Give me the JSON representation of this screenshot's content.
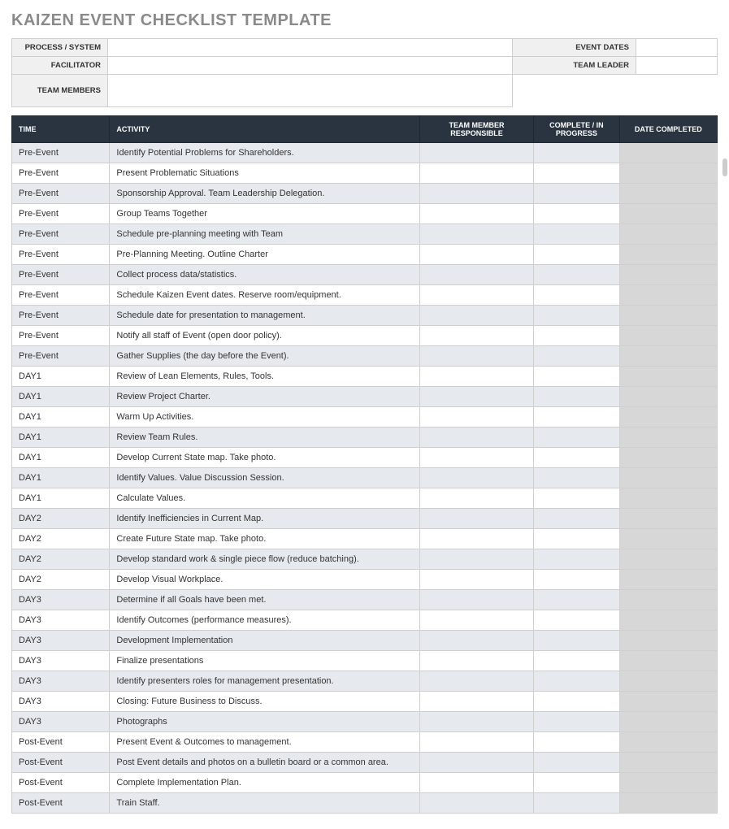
{
  "title": "KAIZEN EVENT CHECKLIST TEMPLATE",
  "info_labels": {
    "process": "PROCESS / SYSTEM",
    "event_dates": "EVENT DATES",
    "facilitator": "FACILITATOR",
    "team_leader": "TEAM LEADER",
    "team_members": "TEAM MEMBERS"
  },
  "info_values": {
    "process": "",
    "event_dates": "",
    "facilitator": "",
    "team_leader": "",
    "team_members": ""
  },
  "columns": {
    "time": "TIME",
    "activity": "ACTIVITY",
    "responsible": "TEAM MEMBER RESPONSIBLE",
    "status": "COMPLETE / IN PROGRESS",
    "date": "DATE COMPLETED"
  },
  "rows": [
    {
      "time": "Pre-Event",
      "activity": "Identify Potential Problems for Shareholders.",
      "responsible": "",
      "status": "",
      "date": ""
    },
    {
      "time": "Pre-Event",
      "activity": "Present Problematic Situations",
      "responsible": "",
      "status": "",
      "date": ""
    },
    {
      "time": "Pre-Event",
      "activity": "Sponsorship Approval. Team Leadership Delegation.",
      "responsible": "",
      "status": "",
      "date": ""
    },
    {
      "time": "Pre-Event",
      "activity": "Group Teams Together",
      "responsible": "",
      "status": "",
      "date": ""
    },
    {
      "time": "Pre-Event",
      "activity": "Schedule pre-planning meeting with Team",
      "responsible": "",
      "status": "",
      "date": ""
    },
    {
      "time": "Pre-Event",
      "activity": "Pre-Planning Meeting. Outline Charter",
      "responsible": "",
      "status": "",
      "date": ""
    },
    {
      "time": "Pre-Event",
      "activity": "Collect process data/statistics.",
      "responsible": "",
      "status": "",
      "date": ""
    },
    {
      "time": "Pre-Event",
      "activity": "Schedule Kaizen Event dates. Reserve room/equipment.",
      "responsible": "",
      "status": "",
      "date": ""
    },
    {
      "time": "Pre-Event",
      "activity": "Schedule date for presentation to management.",
      "responsible": "",
      "status": "",
      "date": ""
    },
    {
      "time": "Pre-Event",
      "activity": "Notify all staff of Event (open door policy).",
      "responsible": "",
      "status": "",
      "date": ""
    },
    {
      "time": "Pre-Event",
      "activity": "Gather Supplies (the day before the Event).",
      "responsible": "",
      "status": "",
      "date": ""
    },
    {
      "time": "DAY1",
      "activity": "Review of Lean Elements, Rules, Tools.",
      "responsible": "",
      "status": "",
      "date": ""
    },
    {
      "time": "DAY1",
      "activity": "Review Project Charter.",
      "responsible": "",
      "status": "",
      "date": ""
    },
    {
      "time": "DAY1",
      "activity": "Warm Up Activities.",
      "responsible": "",
      "status": "",
      "date": ""
    },
    {
      "time": "DAY1",
      "activity": "Review Team Rules.",
      "responsible": "",
      "status": "",
      "date": ""
    },
    {
      "time": "DAY1",
      "activity": "Develop Current State map. Take photo.",
      "responsible": "",
      "status": "",
      "date": ""
    },
    {
      "time": "DAY1",
      "activity": "Identify Values. Value Discussion Session.",
      "responsible": "",
      "status": "",
      "date": ""
    },
    {
      "time": "DAY1",
      "activity": "Calculate Values.",
      "responsible": "",
      "status": "",
      "date": ""
    },
    {
      "time": "DAY2",
      "activity": "Identify Inefficiencies in Current Map.",
      "responsible": "",
      "status": "",
      "date": ""
    },
    {
      "time": "DAY2",
      "activity": "Create Future State map. Take photo.",
      "responsible": "",
      "status": "",
      "date": ""
    },
    {
      "time": "DAY2",
      "activity": "Develop standard work & single piece flow (reduce batching).",
      "responsible": "",
      "status": "",
      "date": ""
    },
    {
      "time": "DAY2",
      "activity": "Develop Visual Workplace.",
      "responsible": "",
      "status": "",
      "date": ""
    },
    {
      "time": "DAY3",
      "activity": "Determine if all Goals have been met.",
      "responsible": "",
      "status": "",
      "date": ""
    },
    {
      "time": "DAY3",
      "activity": "Identify Outcomes (performance measures).",
      "responsible": "",
      "status": "",
      "date": ""
    },
    {
      "time": "DAY3",
      "activity": "Development Implementation",
      "responsible": "",
      "status": "",
      "date": ""
    },
    {
      "time": "DAY3",
      "activity": "Finalize presentations",
      "responsible": "",
      "status": "",
      "date": ""
    },
    {
      "time": "DAY3",
      "activity": "Identify presenters roles for management presentation.",
      "responsible": "",
      "status": "",
      "date": ""
    },
    {
      "time": "DAY3",
      "activity": "Closing: Future Business to Discuss.",
      "responsible": "",
      "status": "",
      "date": ""
    },
    {
      "time": "DAY3",
      "activity": "Photographs",
      "responsible": "",
      "status": "",
      "date": ""
    },
    {
      "time": "Post-Event",
      "activity": "Present Event & Outcomes to management.",
      "responsible": "",
      "status": "",
      "date": ""
    },
    {
      "time": "Post-Event",
      "activity": "Post Event details and photos on a bulletin board or a common area.",
      "responsible": "",
      "status": "",
      "date": ""
    },
    {
      "time": "Post-Event",
      "activity": "Complete Implementation Plan.",
      "responsible": "",
      "status": "",
      "date": ""
    },
    {
      "time": "Post-Event",
      "activity": "Train Staff.",
      "responsible": "",
      "status": "",
      "date": ""
    }
  ]
}
